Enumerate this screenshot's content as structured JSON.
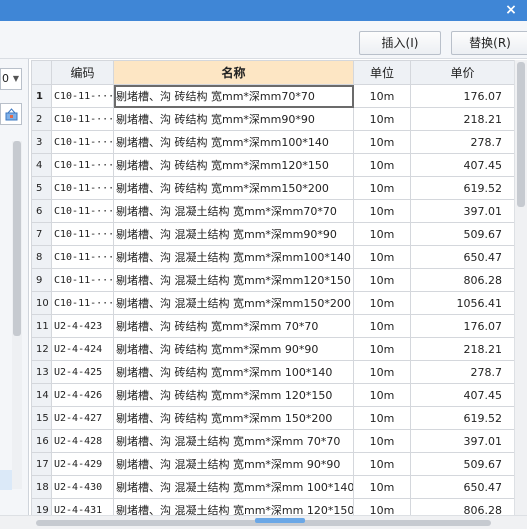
{
  "window": {
    "close_glyph": "×"
  },
  "toolbar": {
    "insert_label": "插入(I)",
    "replace_label": "替换(R)"
  },
  "left_panel": {
    "combo_value": "0"
  },
  "table": {
    "headers": {
      "code": "编码",
      "name": "名称",
      "unit": "单位",
      "price": "单价"
    },
    "rows": [
      {
        "n": "1",
        "code": "C10-11-···",
        "name": "剔堵槽、沟 砖结构 宽mm*深mm70*70",
        "unit": "10m",
        "price": "176.07"
      },
      {
        "n": "2",
        "code": "C10-11-···",
        "name": "剔堵槽、沟 砖结构 宽mm*深mm90*90",
        "unit": "10m",
        "price": "218.21"
      },
      {
        "n": "3",
        "code": "C10-11-···",
        "name": "剔堵槽、沟 砖结构 宽mm*深mm100*140",
        "unit": "10m",
        "price": "278.7"
      },
      {
        "n": "4",
        "code": "C10-11-···",
        "name": "剔堵槽、沟 砖结构 宽mm*深mm120*150",
        "unit": "10m",
        "price": "407.45"
      },
      {
        "n": "5",
        "code": "C10-11-···",
        "name": "剔堵槽、沟 砖结构 宽mm*深mm150*200",
        "unit": "10m",
        "price": "619.52"
      },
      {
        "n": "6",
        "code": "C10-11-···",
        "name": "剔堵槽、沟 混凝土结构 宽mm*深mm70*70",
        "unit": "10m",
        "price": "397.01"
      },
      {
        "n": "7",
        "code": "C10-11-···",
        "name": "剔堵槽、沟 混凝土结构 宽mm*深mm90*90",
        "unit": "10m",
        "price": "509.67"
      },
      {
        "n": "8",
        "code": "C10-11-···",
        "name": "剔堵槽、沟 混凝土结构 宽mm*深mm100*140",
        "unit": "10m",
        "price": "650.47"
      },
      {
        "n": "9",
        "code": "C10-11-···",
        "name": "剔堵槽、沟 混凝土结构 宽mm*深mm120*150",
        "unit": "10m",
        "price": "806.28"
      },
      {
        "n": "10",
        "code": "C10-11-···",
        "name": "剔堵槽、沟 混凝土结构 宽mm*深mm150*200",
        "unit": "10m",
        "price": "1056.41"
      },
      {
        "n": "11",
        "code": "U2-4-423",
        "name": "剔堵槽、沟 砖结构 宽mm*深mm 70*70",
        "unit": "10m",
        "price": "176.07"
      },
      {
        "n": "12",
        "code": "U2-4-424",
        "name": "剔堵槽、沟 砖结构 宽mm*深mm 90*90",
        "unit": "10m",
        "price": "218.21"
      },
      {
        "n": "13",
        "code": "U2-4-425",
        "name": "剔堵槽、沟 砖结构 宽mm*深mm 100*140",
        "unit": "10m",
        "price": "278.7"
      },
      {
        "n": "14",
        "code": "U2-4-426",
        "name": "剔堵槽、沟 砖结构 宽mm*深mm 120*150",
        "unit": "10m",
        "price": "407.45"
      },
      {
        "n": "15",
        "code": "U2-4-427",
        "name": "剔堵槽、沟 砖结构 宽mm*深mm 150*200",
        "unit": "10m",
        "price": "619.52"
      },
      {
        "n": "16",
        "code": "U2-4-428",
        "name": "剔堵槽、沟 混凝土结构 宽mm*深mm 70*70",
        "unit": "10m",
        "price": "397.01"
      },
      {
        "n": "17",
        "code": "U2-4-429",
        "name": "剔堵槽、沟 混凝土结构 宽mm*深mm 90*90",
        "unit": "10m",
        "price": "509.67"
      },
      {
        "n": "18",
        "code": "U2-4-430",
        "name": "剔堵槽、沟 混凝土结构 宽mm*深mm 100*140",
        "unit": "10m",
        "price": "650.47"
      },
      {
        "n": "19",
        "code": "U2-4-431",
        "name": "剔堵槽、沟 混凝土结构 宽mm*深mm 120*150",
        "unit": "10m",
        "price": "806.28"
      }
    ]
  }
}
